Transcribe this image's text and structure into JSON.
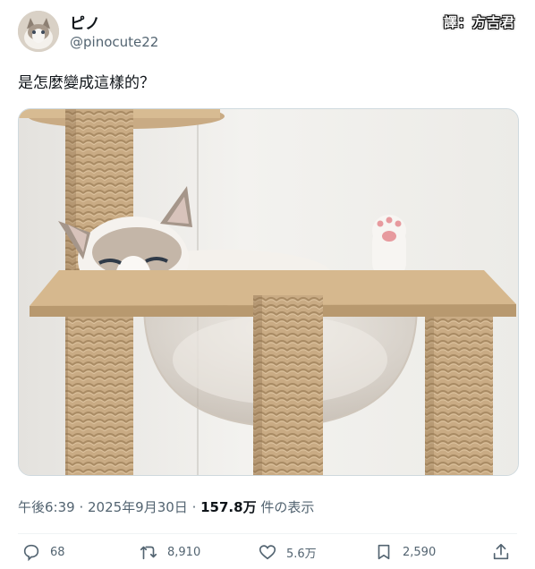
{
  "author": {
    "display_name": "ピノ",
    "handle": "@pinocute22",
    "avatar_icon": "cat-avatar"
  },
  "credit_watermark": "譯：方吉君",
  "tweet": {
    "text": "是怎麼變成這樣的？",
    "image_description_icon": "cat-tree-photo"
  },
  "meta": {
    "time": "午後6:39",
    "separator1": " · ",
    "date": "2025年9月30日",
    "separator2": " · ",
    "views_count": "157.8万",
    "views_label": " 件の表示"
  },
  "actions": {
    "replies": "68",
    "retweets": "8,910",
    "likes": "5.6万",
    "bookmarks": "2,590"
  },
  "colors": {
    "text_primary": "#0f1419",
    "text_secondary": "#536471",
    "border": "#cfd9de"
  }
}
